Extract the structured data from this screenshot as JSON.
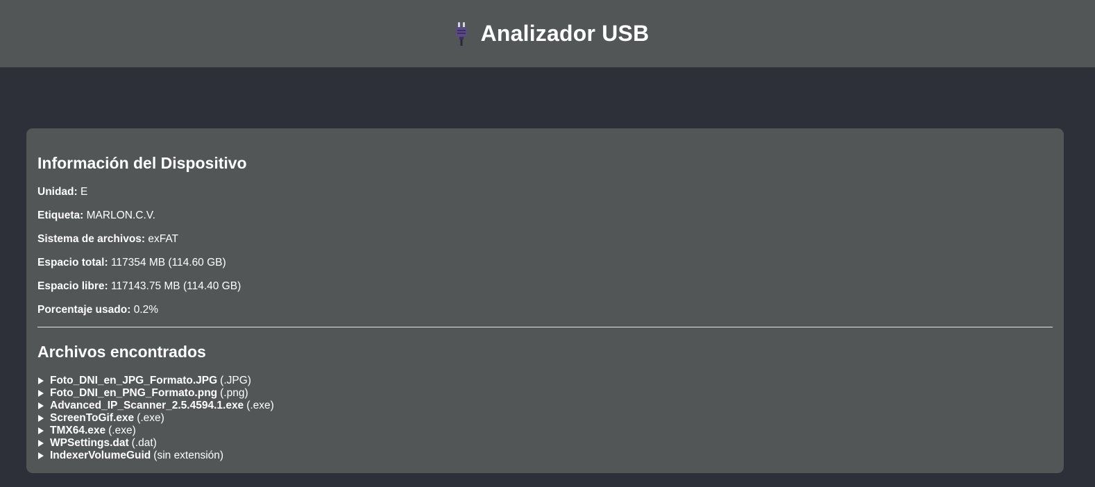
{
  "header": {
    "title": "Analizador USB",
    "icon": "electric-plug-icon"
  },
  "device": {
    "title": "Información del Dispositivo",
    "rows": [
      {
        "label": "Unidad:",
        "value": "E"
      },
      {
        "label": "Etiqueta:",
        "value": "MARLON.C.V."
      },
      {
        "label": "Sistema de archivos:",
        "value": "exFAT"
      },
      {
        "label": "Espacio total:",
        "value": "117354 MB (114.60 GB)"
      },
      {
        "label": "Espacio libre:",
        "value": "117143.75 MB (114.40 GB)"
      },
      {
        "label": "Porcentaje usado:",
        "value": "0.2%"
      }
    ]
  },
  "files": {
    "title": "Archivos encontrados",
    "items": [
      {
        "name": "Foto_DNI_en_JPG_Formato.JPG",
        "ext": "(.JPG)"
      },
      {
        "name": "Foto_DNI_en_PNG_Formato.png",
        "ext": "(.png)"
      },
      {
        "name": "Advanced_IP_Scanner_2.5.4594.1.exe",
        "ext": "(.exe)"
      },
      {
        "name": "ScreenToGif.exe",
        "ext": "(.exe)"
      },
      {
        "name": "TMX64.exe",
        "ext": "(.exe)"
      },
      {
        "name": "WPSettings.dat",
        "ext": "(.dat)"
      },
      {
        "name": "IndexerVolumeGuid",
        "ext": "(sin extensión)"
      }
    ]
  },
  "colors": {
    "background": "#2d3038",
    "panel": "#525657",
    "text": "#ffffff",
    "plug_accent": "#5b4a86"
  }
}
